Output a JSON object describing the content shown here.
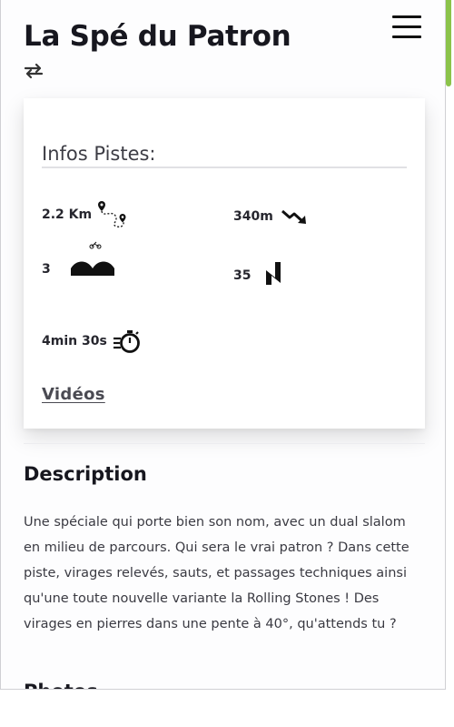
{
  "header": {
    "title": "La Spé du Patron"
  },
  "icons": {
    "swap": "swap-arrows-icon",
    "menu": "hamburger-menu-icon",
    "distance": "route-distance-icon",
    "elevation": "downhill-arrow-icon",
    "jumps": "bumps-terrain-icon",
    "turns": "switchback-turns-icon",
    "time": "stopwatch-icon"
  },
  "infos": {
    "heading": "Infos Pistes:",
    "distance": "2.2 Km",
    "elevation": "340m",
    "jumps": "3",
    "turns": "35",
    "time": "4min 30s",
    "videos_link": "Vidéos"
  },
  "description": {
    "title": "Description",
    "text": "Une spéciale qui porte bien son nom, avec un dual slalom en milieu de parcours. Qui sera le vrai patron ? Dans cette piste, virages relevés, sauts, et passages techniques ainsi qu'une toute nouvelle variante la Rolling Stones ! Des virages en pierres dans une pente à 40°, qu'attends tu ?"
  },
  "photos": {
    "title": "Photos"
  },
  "colors": {
    "accent": "#8bc34a",
    "text": "#17171f"
  }
}
